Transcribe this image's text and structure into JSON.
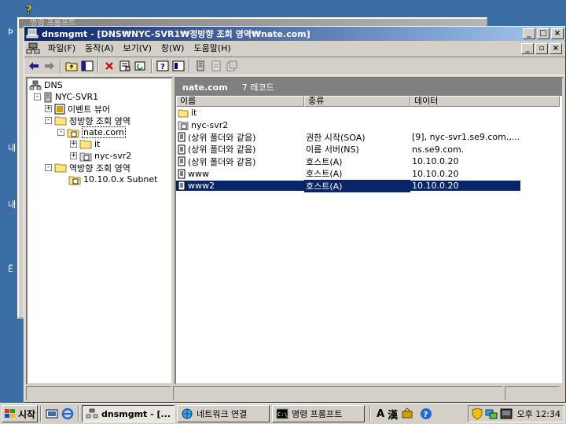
{
  "background_window": {
    "title": "명령 프롬프트"
  },
  "window": {
    "title": "dnsmgmt - [DNS₩NYC-SVR1₩정방향 조회 영역₩nate.com]",
    "caption_buttons": [
      "_",
      "□",
      "×"
    ]
  },
  "menu": {
    "items": [
      "파일(F)",
      "동작(A)",
      "보기(V)",
      "창(W)",
      "도움말(H)"
    ],
    "mdi_buttons": [
      "_",
      "▫",
      "×"
    ]
  },
  "toolbar": {
    "icons": [
      "back-arrow-icon",
      "forward-arrow-icon",
      "up-folder-icon",
      "show-hide-tree-icon",
      "delete-icon",
      "properties-icon",
      "refresh-icon",
      "help-icon",
      "console-icon",
      "new-server-icon",
      "new-record-icon",
      "new-domain-icon"
    ]
  },
  "tree": {
    "nodes": [
      {
        "label": "DNS",
        "icon": "dns-icon",
        "level": 0
      },
      {
        "label": "NYC-SVR1",
        "icon": "server-icon",
        "level": 1,
        "expander": "-"
      },
      {
        "label": "이벤트 뷰어",
        "icon": "event-viewer-icon",
        "level": 2,
        "expander": "+"
      },
      {
        "label": "정방향 조회 영역",
        "icon": "folder-icon",
        "level": 2,
        "expander": "-"
      },
      {
        "label": "nate.com",
        "icon": "zone-icon",
        "level": 3,
        "expander": "-",
        "selected": true
      },
      {
        "label": "it",
        "icon": "folder-icon",
        "level": 4,
        "expander": "+"
      },
      {
        "label": "nyc-svr2",
        "icon": "zone-icon",
        "level": 4,
        "expander": "+"
      },
      {
        "label": "역방향 조회 영역",
        "icon": "folder-icon",
        "level": 2,
        "expander": "-"
      },
      {
        "label": "10.10.0.x Subnet",
        "icon": "zone-icon",
        "level": 3
      }
    ]
  },
  "list": {
    "header_title": "nate.com",
    "header_count": "7 레코드",
    "columns": [
      "이름",
      "종류",
      "데이터"
    ],
    "rows": [
      {
        "name": "it",
        "type": "",
        "data": "",
        "icon": "folder-icon"
      },
      {
        "name": "nyc-svr2",
        "type": "",
        "data": "",
        "icon": "zone-icon"
      },
      {
        "name": "(상위 폴더와 같음)",
        "type": "권한 시작(SOA)",
        "data": "[9], nyc-svr1.se9.com.,...",
        "icon": "record-icon"
      },
      {
        "name": "(상위 폴더와 같음)",
        "type": "이름 서버(NS)",
        "data": "ns.se9.com.",
        "icon": "record-icon"
      },
      {
        "name": "(상위 폴더와 같음)",
        "type": "호스트(A)",
        "data": "10.10.0.20",
        "icon": "record-icon"
      },
      {
        "name": "www",
        "type": "호스트(A)",
        "data": "10.10.0.20",
        "icon": "record-icon"
      },
      {
        "name": "www2",
        "type": "호스트(A)",
        "data": "10.10.0.20",
        "icon": "record-icon",
        "selected": true
      }
    ]
  },
  "taskbar": {
    "start_label": "시작",
    "tasks": [
      {
        "label": "dnsmgmt - [...",
        "active": true
      },
      {
        "label": "네트워크 연결",
        "active": false
      },
      {
        "label": "명령 프롬프트",
        "active": false
      }
    ],
    "ime_a": "A",
    "ime_han": "漢",
    "clock": "오후 12:34"
  }
}
